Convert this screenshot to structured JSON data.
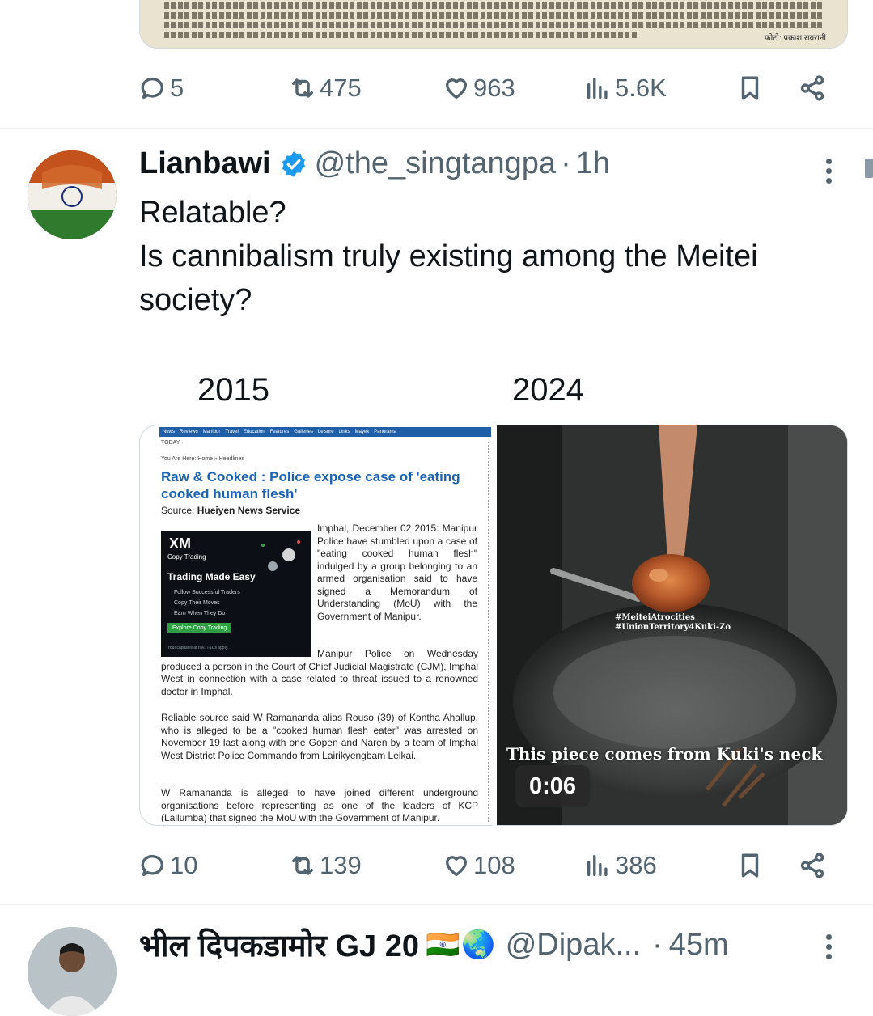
{
  "top_tweet": {
    "clip_caption": "फोटो: प्रकाश रावरानी",
    "actions": {
      "replies": "5",
      "retweets": "475",
      "likes": "963",
      "views": "5.6K"
    }
  },
  "tweet": {
    "author_name": "Lianbawi",
    "handle": "@the_singtangpa",
    "separator": "·",
    "time": "1h",
    "text_line1": "Relatable?",
    "text_line2": "Is cannibalism truly existing among the Meitei",
    "text_line3": "society?",
    "year_left": "2015",
    "year_right": "2024",
    "news_site": {
      "nav": [
        "News",
        "Reviews",
        "Manipur",
        "Travel",
        "Education",
        "Features",
        "Galleries",
        "Leisure",
        "Links",
        "Mayek",
        "Panorama"
      ],
      "today": "TODAY ·",
      "breadcrumb": "You Are Here: Home » Headlines",
      "headline": "Raw & Cooked : Police expose case of 'eating cooked human flesh'",
      "source_label": "Source:",
      "source": "Hueiyen News Service",
      "para1": "Imphal, December 02 2015: Manipur Police have stumbled upon a case of \"eating cooked human flesh\" indulged by a group belonging to an armed organisation said to have signed a Memorandum of Understanding (MoU) with the Government of Manipur.",
      "para2": "Manipur Police on Wednesday produced a person in the Court of Chief Judicial Magistrate (CJM), Imphal West in connection with a case related to threat issued to a renowned doctor in Imphal.",
      "para3": "Reliable source said W Ramananda alias Rouso (39) of Kontha Ahallup, who is alleged to be a \"cooked human flesh eater\" was arrested on November 19 last along with one Gopen and Naren by a team of Imphal West District Police Commando from Lairikyengbam Leikai.",
      "para4": "W Ramananda is alleged to have joined different underground organisations before representing as one of the leaders of KCP (Lallumba) that signed the MoU with the Government of Manipur.",
      "ad": {
        "brand": "XM",
        "sub": "Copy Trading",
        "title": "Trading Made Easy",
        "bullets": [
          "Follow Successful Traders",
          "Copy Their Moves",
          "Earn When They Do"
        ],
        "cta": "Explore Copy Trading",
        "fine": "Your capital is at risk. T&Cs apply."
      }
    },
    "video": {
      "hashtag1": "#MeiteiAtrocities",
      "hashtag2": "#UnionTerritory4Kuki-Zo",
      "caption": "This piece comes from Kuki's neck",
      "duration": "0:06"
    },
    "actions": {
      "replies": "10",
      "retweets": "139",
      "likes": "108",
      "views": "386"
    }
  },
  "next_tweet": {
    "author_name": "भील दिपकडामोर GJ 20",
    "flag_emoji": "🇮🇳",
    "globe_emoji": "🌏",
    "handle": "@Dipak...",
    "separator": "·",
    "time": "45m"
  }
}
